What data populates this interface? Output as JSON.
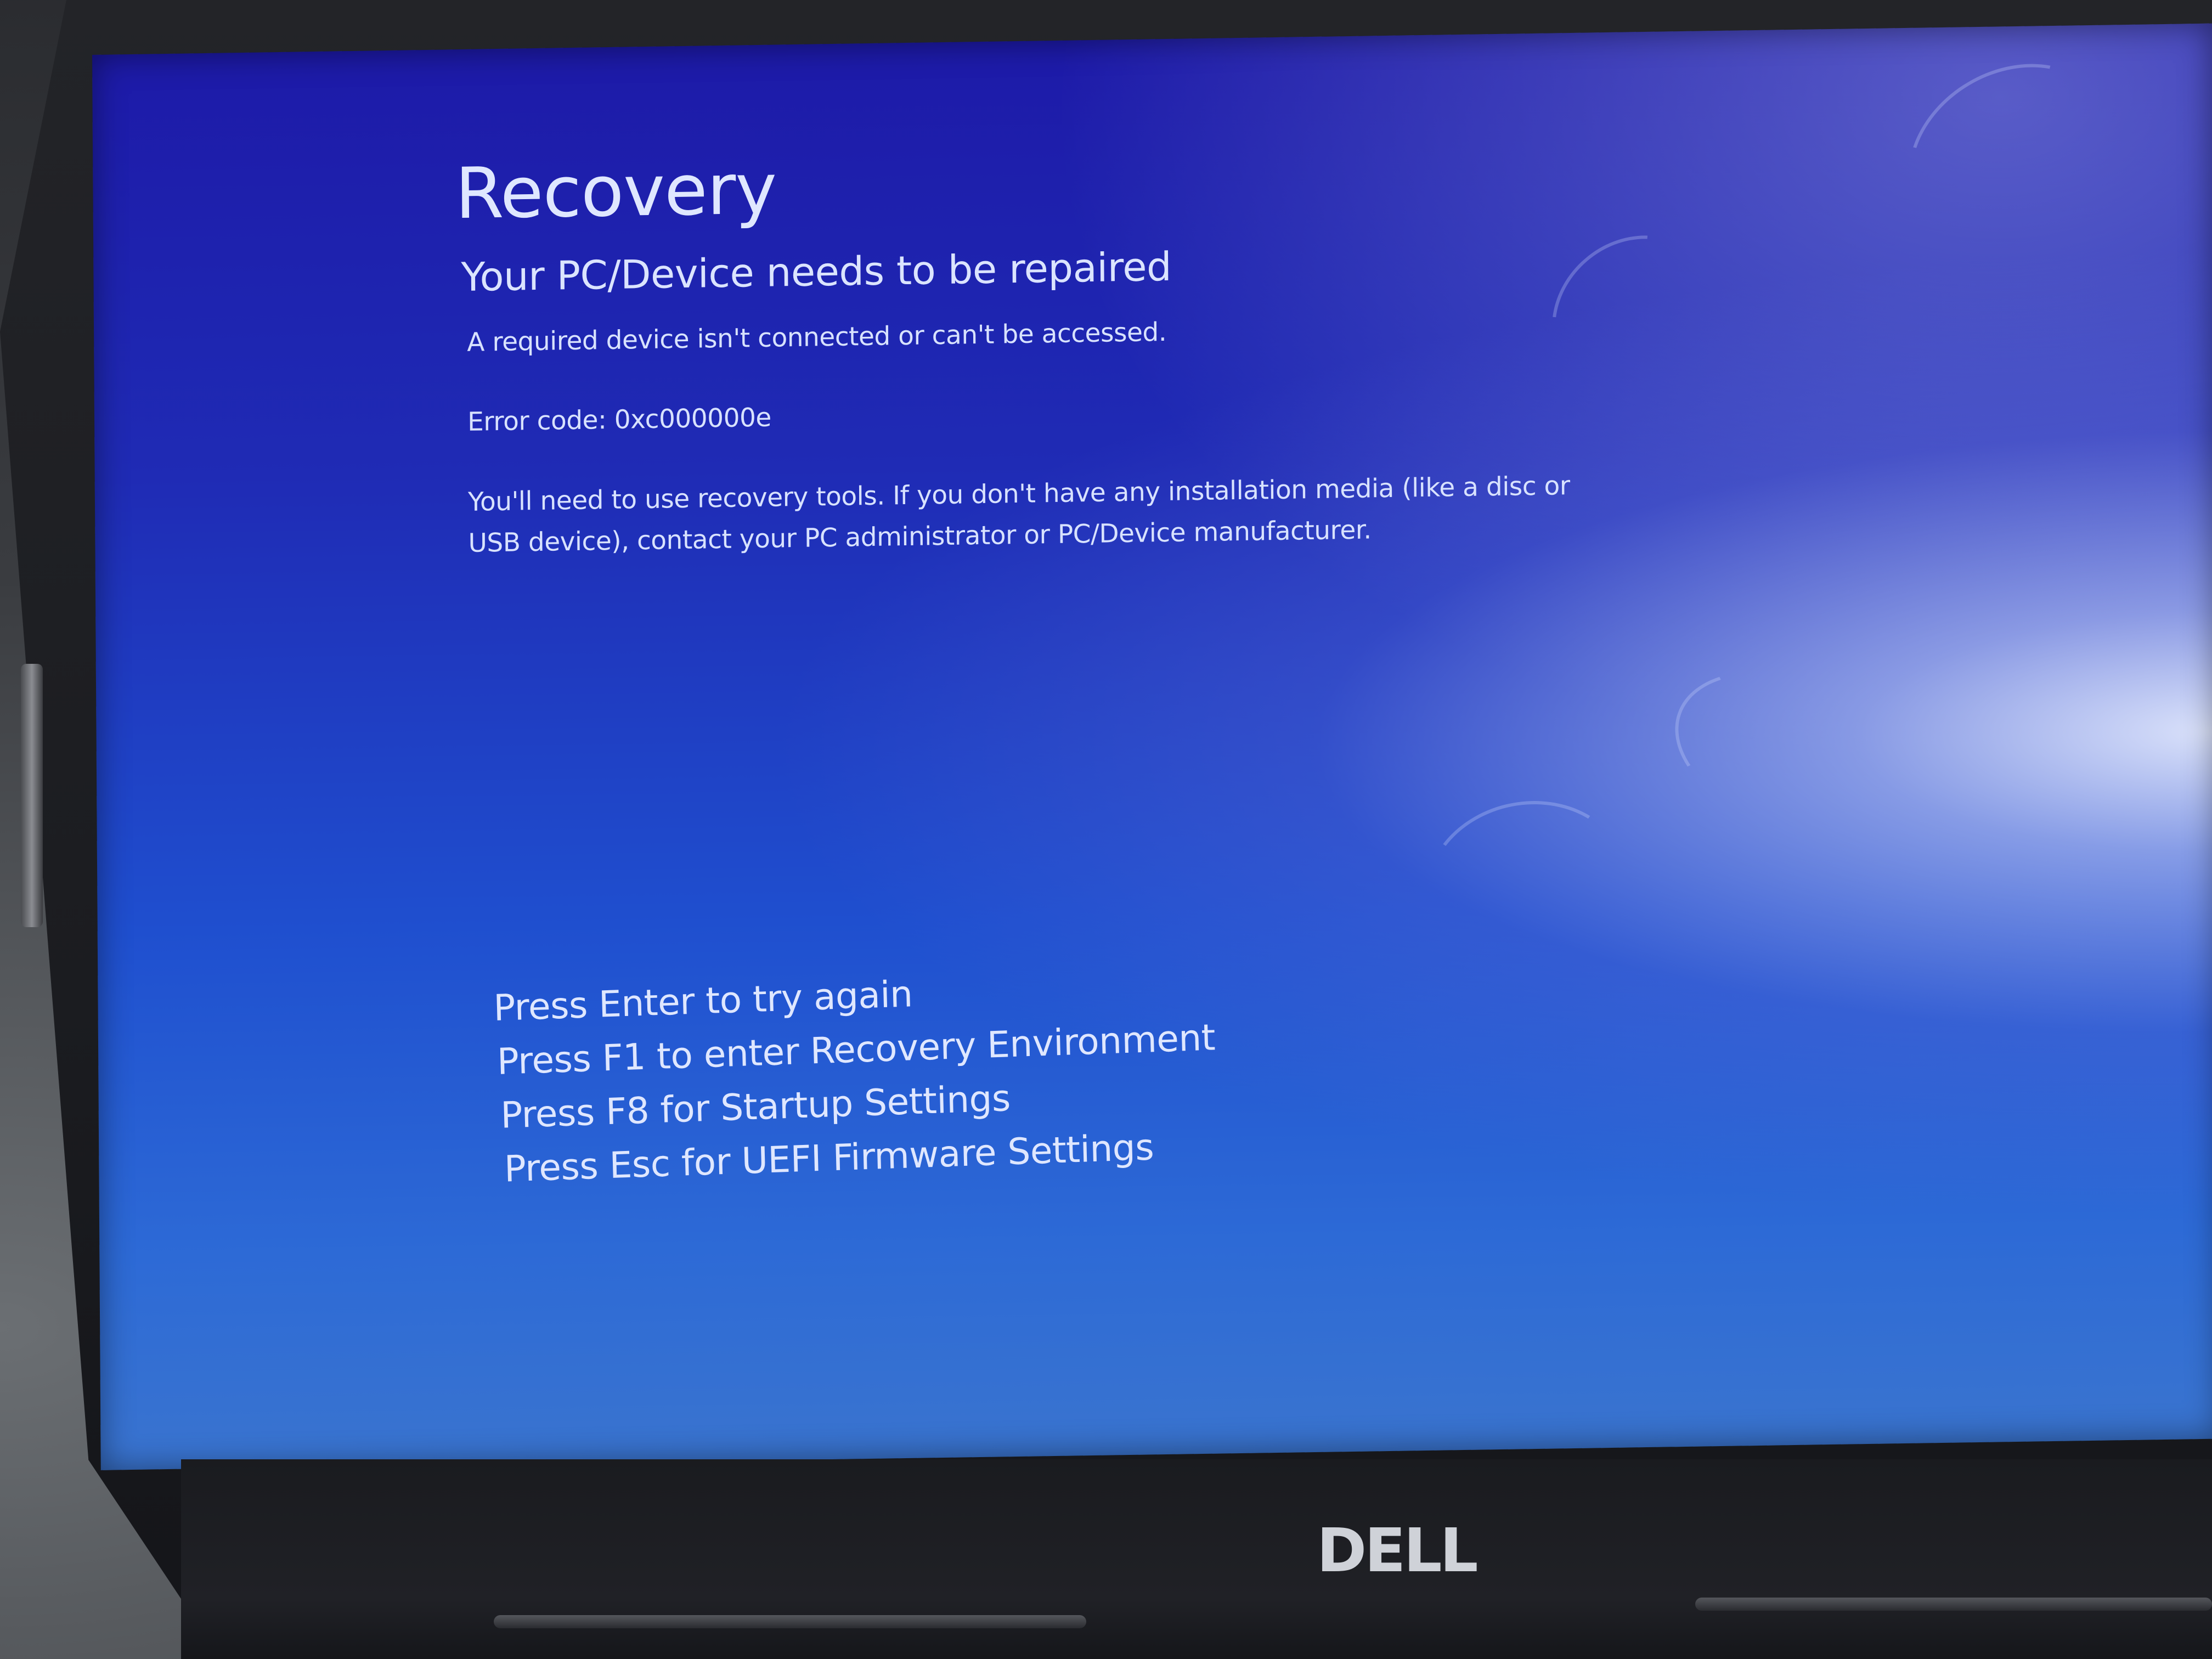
{
  "recovery_screen": {
    "title": "Recovery",
    "subtitle": "Your PC/Device needs to be repaired",
    "description": "A required device isn't connected or can't be accessed.",
    "error_code": "Error code: 0xc000000e",
    "recovery_tools_message": "You'll need to use recovery tools. If you don't have any installation media (like a disc or USB device), contact your PC administrator or PC/Device manufacturer.",
    "options": [
      "Press Enter to try again",
      "Press F1 to enter Recovery Environment",
      "Press F8 for Startup Settings",
      "Press Esc for UEFI Firmware Settings"
    ]
  },
  "device": {
    "logo": "DELL"
  },
  "colors": {
    "screen_blue": "#1f2bb5",
    "text": "#dfe7ff",
    "bezel": "#1c1d21"
  }
}
